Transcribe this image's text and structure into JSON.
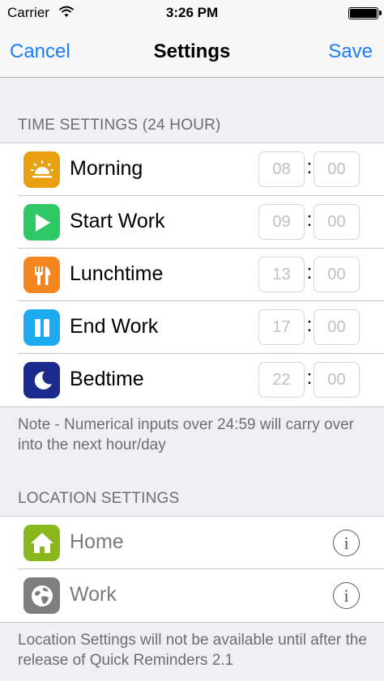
{
  "status": {
    "carrier": "Carrier",
    "time": "3:26 PM"
  },
  "nav": {
    "cancel": "Cancel",
    "title": "Settings",
    "save": "Save"
  },
  "time_settings": {
    "header": "TIME SETTINGS (24 HOUR)",
    "rows": [
      {
        "label": "Morning",
        "icon": "sunrise-icon",
        "color": "#e8a010",
        "hours": "08",
        "minutes": "00"
      },
      {
        "label": "Start Work",
        "icon": "play-icon",
        "color": "#2ec866",
        "hours": "09",
        "minutes": "00"
      },
      {
        "label": "Lunchtime",
        "icon": "fork-knife-icon",
        "color": "#f5861f",
        "hours": "13",
        "minutes": "00"
      },
      {
        "label": "End Work",
        "icon": "pause-icon",
        "color": "#1eaaf1",
        "hours": "17",
        "minutes": "00"
      },
      {
        "label": "Bedtime",
        "icon": "moon-icon",
        "color": "#1b2a8c",
        "hours": "22",
        "minutes": "00"
      }
    ],
    "colon": ":",
    "note": "Note - Numerical inputs over 24:59 will carry over into the next hour/day"
  },
  "location_settings": {
    "header": "LOCATION SETTINGS",
    "rows": [
      {
        "label": "Home",
        "icon": "home-icon",
        "color": "#8ab61e"
      },
      {
        "label": "Work",
        "icon": "globe-icon",
        "color": "#7e7e7e"
      }
    ],
    "info_glyph": "i",
    "note": "Location Settings will not be available until after the release of Quick Reminders 2.1"
  }
}
